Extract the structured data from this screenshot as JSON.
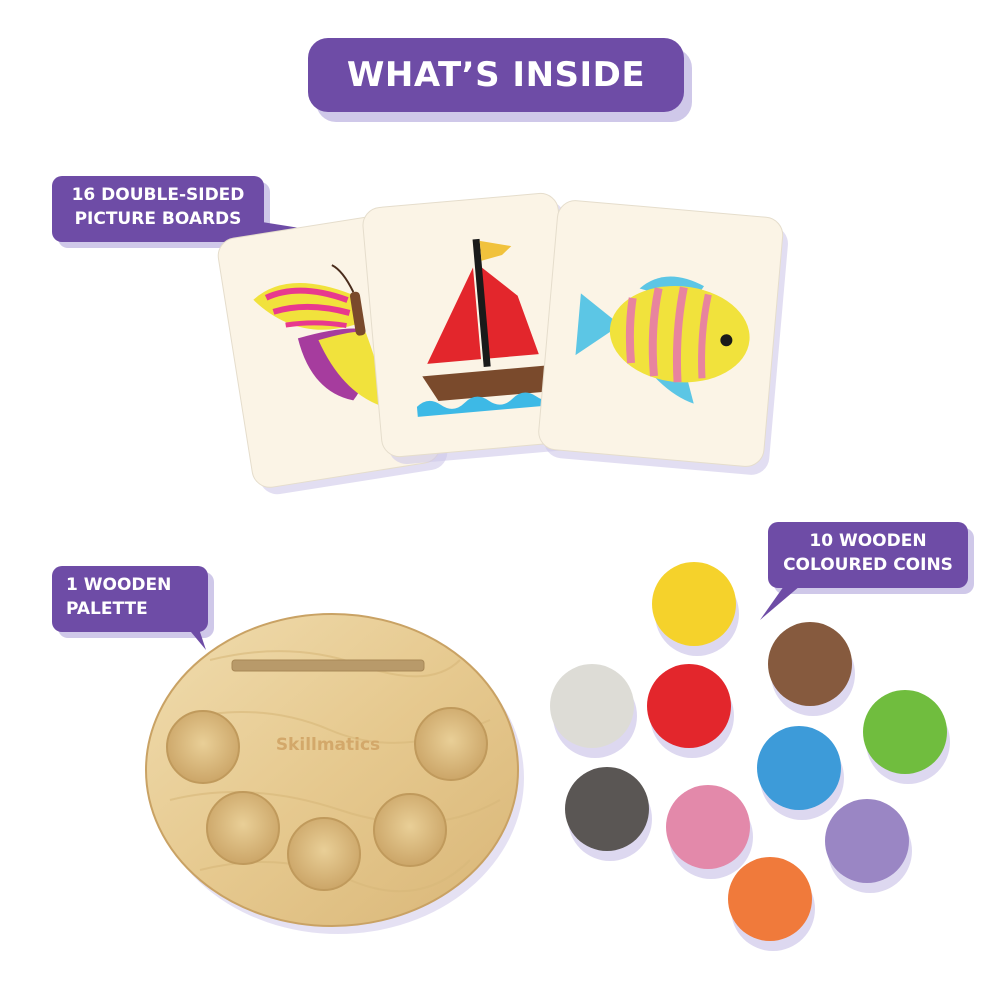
{
  "title": "WHAT’S INSIDE",
  "labels": {
    "boards": {
      "line1": "16 DOUBLE-SIDED",
      "line2": "PICTURE BOARDS"
    },
    "palette": {
      "line1": "1 WOODEN",
      "line2": "PALETTE"
    },
    "coins": {
      "line1": "10 WOODEN",
      "line2": "COLOURED COINS"
    }
  },
  "palette_brand": "Skillmatics",
  "cards": [
    {
      "name": "butterfly-card",
      "icon": "butterfly-icon"
    },
    {
      "name": "sailboat-card",
      "icon": "sailboat-icon"
    },
    {
      "name": "fish-card",
      "icon": "fish-icon"
    }
  ],
  "coin_colors": {
    "yellow": "#f5d22b",
    "brown": "#865a3e",
    "white": "#dddcd6",
    "red": "#e3262c",
    "green": "#70bd3e",
    "blue": "#3d9bd9",
    "black": "#5a5654",
    "pink": "#e389aa",
    "purple": "#9a86c4",
    "orange": "#f07a3b"
  },
  "colors": {
    "accent": "#6e4ca6",
    "shadow": "#cfc8e9",
    "wood": "#e8cf98"
  }
}
